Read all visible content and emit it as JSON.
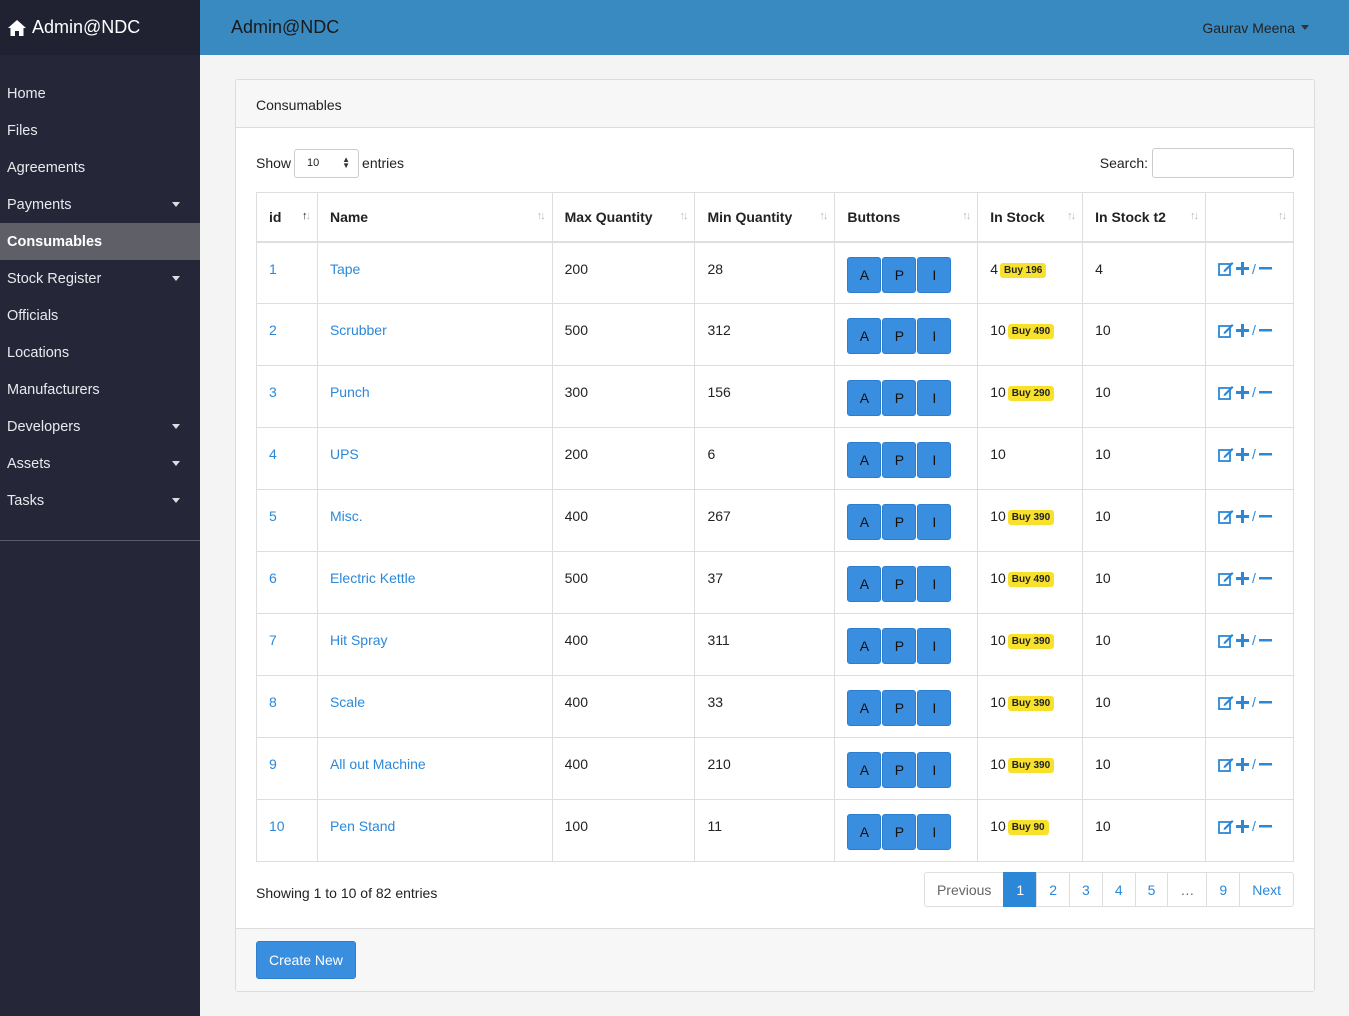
{
  "brand": {
    "label": "Admin@NDC"
  },
  "topbar": {
    "title": "Admin@NDC",
    "user": "Gaurav Meena"
  },
  "sidebar": {
    "items": [
      {
        "label": "Home",
        "dropdown": false
      },
      {
        "label": "Files",
        "dropdown": false
      },
      {
        "label": "Agreements",
        "dropdown": false
      },
      {
        "label": "Payments",
        "dropdown": true
      },
      {
        "label": "Consumables",
        "dropdown": false,
        "active": true
      },
      {
        "label": "Stock Register",
        "dropdown": true
      },
      {
        "label": "Officials",
        "dropdown": false
      },
      {
        "label": "Locations",
        "dropdown": false
      },
      {
        "label": "Manufacturers",
        "dropdown": false
      },
      {
        "label": "Developers",
        "dropdown": true
      },
      {
        "label": "Assets",
        "dropdown": true
      },
      {
        "label": "Tasks",
        "dropdown": true
      }
    ]
  },
  "card": {
    "title": "Consumables"
  },
  "controls": {
    "show_label": "Show",
    "length_value": "10",
    "entries_label": "entries",
    "search_label": "Search:",
    "search_value": ""
  },
  "table": {
    "headers": [
      "id",
      "Name",
      "Max Quantity",
      "Min Quantity",
      "Buttons",
      "In Stock",
      "In Stock t2",
      ""
    ],
    "button_labels": [
      "A",
      "P",
      "I"
    ],
    "rows": [
      {
        "id": "1",
        "name": "Tape",
        "max": "200",
        "min": "28",
        "stock": "4",
        "buy": "Buy 196",
        "stock2": "4"
      },
      {
        "id": "2",
        "name": "Scrubber",
        "max": "500",
        "min": "312",
        "stock": "10",
        "buy": "Buy 490",
        "stock2": "10"
      },
      {
        "id": "3",
        "name": "Punch",
        "max": "300",
        "min": "156",
        "stock": "10",
        "buy": "Buy 290",
        "stock2": "10"
      },
      {
        "id": "4",
        "name": "UPS",
        "max": "200",
        "min": "6",
        "stock": "10",
        "buy": "",
        "stock2": "10"
      },
      {
        "id": "5",
        "name": "Misc.",
        "max": "400",
        "min": "267",
        "stock": "10",
        "buy": "Buy 390",
        "stock2": "10"
      },
      {
        "id": "6",
        "name": "Electric Kettle",
        "max": "500",
        "min": "37",
        "stock": "10",
        "buy": "Buy 490",
        "stock2": "10"
      },
      {
        "id": "7",
        "name": "Hit Spray",
        "max": "400",
        "min": "311",
        "stock": "10",
        "buy": "Buy 390",
        "stock2": "10"
      },
      {
        "id": "8",
        "name": "Scale",
        "max": "400",
        "min": "33",
        "stock": "10",
        "buy": "Buy 390",
        "stock2": "10"
      },
      {
        "id": "9",
        "name": "All out Machine",
        "max": "400",
        "min": "210",
        "stock": "10",
        "buy": "Buy 390",
        "stock2": "10"
      },
      {
        "id": "10",
        "name": "Pen Stand",
        "max": "100",
        "min": "11",
        "stock": "10",
        "buy": "Buy 90",
        "stock2": "10"
      }
    ]
  },
  "info": "Showing 1 to 10 of 82 entries",
  "pagination": [
    "Previous",
    "1",
    "2",
    "3",
    "4",
    "5",
    "…",
    "9",
    "Next"
  ],
  "pagination_current": "1",
  "footer": {
    "create_label": "Create New"
  },
  "colors": {
    "sidebar": "#252638",
    "topbar": "#3a8ac2",
    "accent": "#2b88d8",
    "badge": "#f7e12c"
  }
}
